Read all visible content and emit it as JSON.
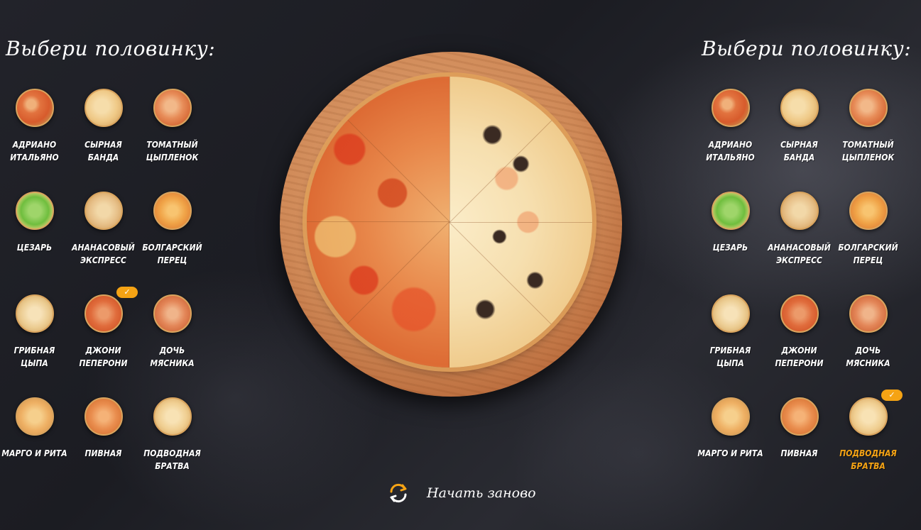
{
  "left_panel": {
    "title": "Выбери половинку:",
    "items": [
      {
        "label": "Адриано итальяно",
        "icon": "pizza-adriano-icon"
      },
      {
        "label": "Сырная банда",
        "icon": "pizza-cheese-icon"
      },
      {
        "label": "Томатный цыпленок",
        "icon": "pizza-tomato-chicken-icon"
      },
      {
        "label": "Цезарь",
        "icon": "pizza-caesar-icon"
      },
      {
        "label": "Ананасовый экспресс",
        "icon": "pizza-pineapple-icon"
      },
      {
        "label": "Болгарский перец",
        "icon": "pizza-pepper-icon"
      },
      {
        "label": "Грибная цыпа",
        "icon": "pizza-mushroom-icon"
      },
      {
        "label": "Джони пеперони",
        "icon": "pizza-pepperoni-icon"
      },
      {
        "label": "Дочь мясника",
        "icon": "pizza-butcher-icon"
      },
      {
        "label": "Марго и Рита",
        "icon": "pizza-margo-icon"
      },
      {
        "label": "Пивная",
        "icon": "pizza-beer-icon"
      },
      {
        "label": "Подводная братва",
        "icon": "pizza-seafood-icon"
      }
    ],
    "selected_index": 7
  },
  "right_panel": {
    "title": "Выбери половинку:",
    "items": [
      {
        "label": "Адриано итальяно",
        "icon": "pizza-adriano-icon"
      },
      {
        "label": "Сырная банда",
        "icon": "pizza-cheese-icon"
      },
      {
        "label": "Томатный цыпленок",
        "icon": "pizza-tomato-chicken-icon"
      },
      {
        "label": "Цезарь",
        "icon": "pizza-caesar-icon"
      },
      {
        "label": "Ананасовый экспресс",
        "icon": "pizza-pineapple-icon"
      },
      {
        "label": "Болгарский перец",
        "icon": "pizza-pepper-icon"
      },
      {
        "label": "Грибная цыпа",
        "icon": "pizza-mushroom-icon"
      },
      {
        "label": "Джони пеперони",
        "icon": "pizza-pepperoni-icon"
      },
      {
        "label": "Дочь мясника",
        "icon": "pizza-butcher-icon"
      },
      {
        "label": "Марго и Рита",
        "icon": "pizza-margo-icon"
      },
      {
        "label": "Пивная",
        "icon": "pizza-beer-icon"
      },
      {
        "label": "Подводная братва",
        "icon": "pizza-seafood-icon"
      }
    ],
    "selected_index": 11
  },
  "check_mark": "✓",
  "restart": {
    "label": "Начать заново",
    "icon": "refresh-icon"
  },
  "colors": {
    "accent": "#f5a314",
    "text": "#ffffff",
    "background": "#1f2027"
  }
}
